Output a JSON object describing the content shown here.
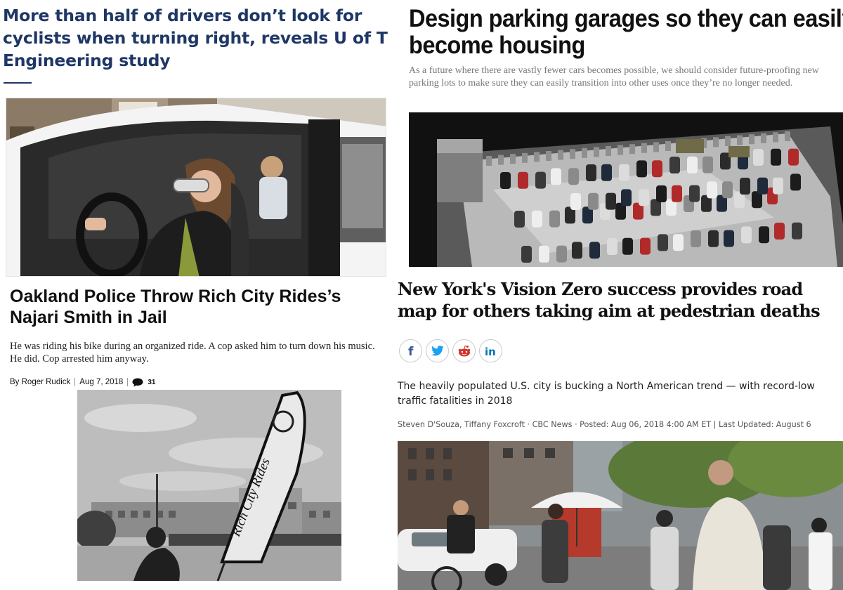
{
  "articles": {
    "uoft": {
      "headline": "More than half of drivers don’t look for cyclists when turning right, reveals U of T Engineering study",
      "accent_color": "#1e3765"
    },
    "parking": {
      "headline_line1": "Design parking garages so they can easily",
      "headline_line2": "become housing",
      "dek": "As a future where there are vastly fewer cars becomes possible, we should consider future-proofing new parking lots to make sure they can easily transition into other uses once they’re no longer needed."
    },
    "oakland": {
      "headline": "Oakland Police Throw Rich City Rides’s Najari Smith in Jail",
      "dek_line1": "He was riding his bike during an organized ride. A cop asked him to turn down his music.",
      "dek_line2": "He did. Cop arrested him anyway.",
      "author": "By Roger Rudick",
      "date": "Aug 7, 2018",
      "comment_count": "31",
      "banner_text": "Rich City Rides"
    },
    "cbc": {
      "headline": "New York's Vision Zero success provides road map for others taking aim at pedestrian deaths",
      "share_icons": [
        "facebook-icon",
        "twitter-icon",
        "reddit-icon",
        "linkedin-icon"
      ],
      "dek": "The heavily populated U.S. city is bucking a North American trend — with record-low traffic fatalities in 2018",
      "meta": "Steven D'Souza, Tiffany Foxcroft · CBC News · Posted: Aug 06, 2018 4:00 AM ET | Last Updated: August 6",
      "brand_colors": {
        "facebook": "#3b5998",
        "twitter": "#1da1f2",
        "reddit": "#d0372b",
        "linkedin": "#0077b5"
      }
    }
  }
}
